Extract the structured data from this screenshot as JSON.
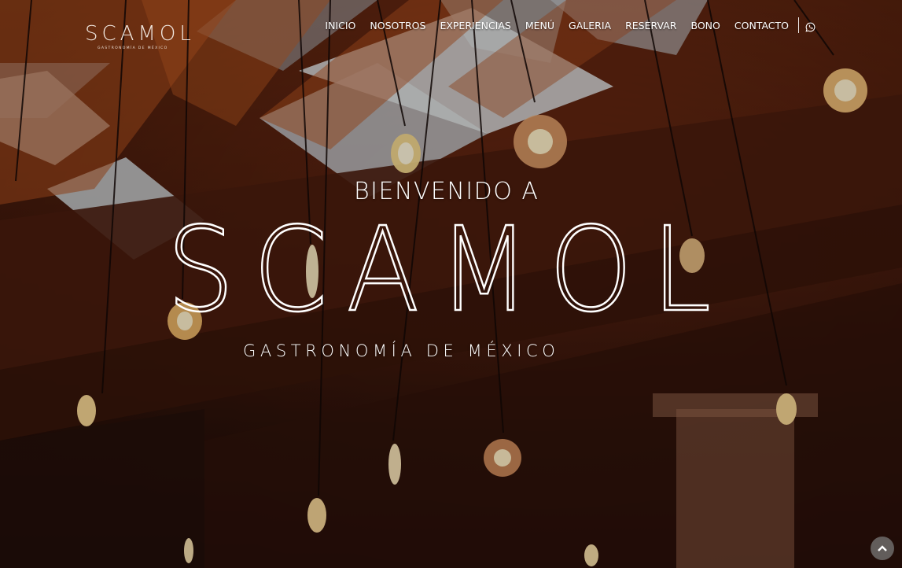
{
  "brand": {
    "logo_word": "SCAMOL",
    "logo_sub": "GASTRONOMÍA DE MÉXICO"
  },
  "nav": {
    "items": [
      "INICIO",
      "NOSOTROS",
      "EXPERIENCIAS",
      "MENÚ",
      "GALERIA",
      "RESERVAR",
      "BONO",
      "CONTACTO"
    ],
    "contact_icon": "whatsapp-icon"
  },
  "hero": {
    "welcome": "BIENVENIDO A",
    "title": "SCAMOL",
    "tagline": "GASTRONOMÍA DE MÉXICO"
  },
  "controls": {
    "scroll_top_icon": "chevron-up-icon"
  },
  "colors": {
    "accent": "#ffffff",
    "background_warm": "#7a2f14",
    "background_dark": "#2a100a"
  }
}
